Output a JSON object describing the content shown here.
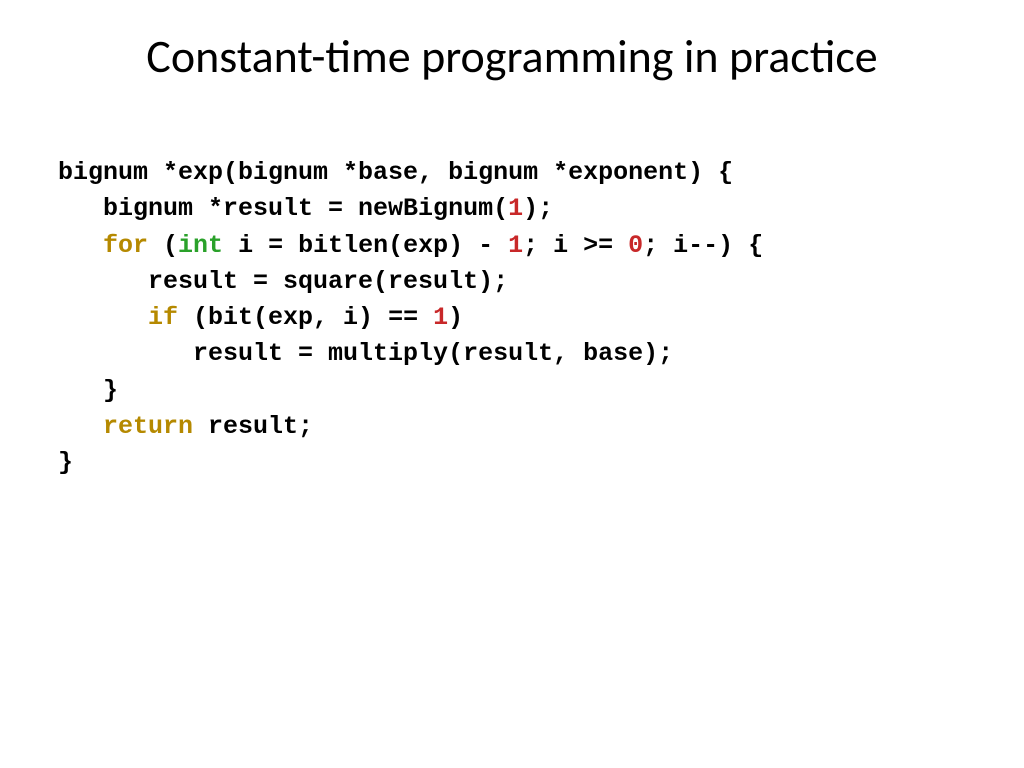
{
  "title": "Constant-time programming in practice",
  "code": {
    "line1_a": "bignum *exp(bignum *base, bignum *exponent) {",
    "line2_a": "   bignum *result = newBignum(",
    "line2_b": "1",
    "line2_c": ");",
    "line3_a": "   ",
    "line3_for": "for",
    "line3_b": " (",
    "line3_int": "int",
    "line3_c": " i = bitlen(exp) - ",
    "line3_d": "1",
    "line3_e": "; i >= ",
    "line3_f": "0",
    "line3_g": "; i--) {",
    "line4_a": "      result = square(result);",
    "line5_a": "      ",
    "line5_if": "if",
    "line5_b": " (bit(exp, i) == ",
    "line5_c": "1",
    "line5_d": ")",
    "line6_a": "         result = multiply(result, base);",
    "line7_a": "   }",
    "line8_a": "   ",
    "line8_return": "return",
    "line8_b": " result;",
    "line9_a": "}"
  }
}
